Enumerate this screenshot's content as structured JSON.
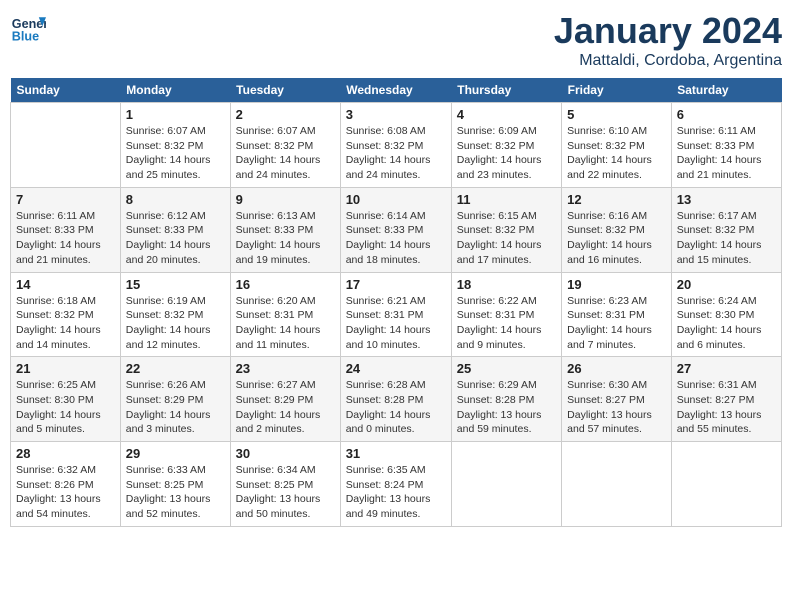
{
  "logo": {
    "line1": "General",
    "line2": "Blue"
  },
  "title": "January 2024",
  "location": "Mattaldi, Cordoba, Argentina",
  "days_header": [
    "Sunday",
    "Monday",
    "Tuesday",
    "Wednesday",
    "Thursday",
    "Friday",
    "Saturday"
  ],
  "weeks": [
    [
      {
        "day": "",
        "info": ""
      },
      {
        "day": "1",
        "info": "Sunrise: 6:07 AM\nSunset: 8:32 PM\nDaylight: 14 hours\nand 25 minutes."
      },
      {
        "day": "2",
        "info": "Sunrise: 6:07 AM\nSunset: 8:32 PM\nDaylight: 14 hours\nand 24 minutes."
      },
      {
        "day": "3",
        "info": "Sunrise: 6:08 AM\nSunset: 8:32 PM\nDaylight: 14 hours\nand 24 minutes."
      },
      {
        "day": "4",
        "info": "Sunrise: 6:09 AM\nSunset: 8:32 PM\nDaylight: 14 hours\nand 23 minutes."
      },
      {
        "day": "5",
        "info": "Sunrise: 6:10 AM\nSunset: 8:32 PM\nDaylight: 14 hours\nand 22 minutes."
      },
      {
        "day": "6",
        "info": "Sunrise: 6:11 AM\nSunset: 8:33 PM\nDaylight: 14 hours\nand 21 minutes."
      }
    ],
    [
      {
        "day": "7",
        "info": "Sunrise: 6:11 AM\nSunset: 8:33 PM\nDaylight: 14 hours\nand 21 minutes."
      },
      {
        "day": "8",
        "info": "Sunrise: 6:12 AM\nSunset: 8:33 PM\nDaylight: 14 hours\nand 20 minutes."
      },
      {
        "day": "9",
        "info": "Sunrise: 6:13 AM\nSunset: 8:33 PM\nDaylight: 14 hours\nand 19 minutes."
      },
      {
        "day": "10",
        "info": "Sunrise: 6:14 AM\nSunset: 8:33 PM\nDaylight: 14 hours\nand 18 minutes."
      },
      {
        "day": "11",
        "info": "Sunrise: 6:15 AM\nSunset: 8:32 PM\nDaylight: 14 hours\nand 17 minutes."
      },
      {
        "day": "12",
        "info": "Sunrise: 6:16 AM\nSunset: 8:32 PM\nDaylight: 14 hours\nand 16 minutes."
      },
      {
        "day": "13",
        "info": "Sunrise: 6:17 AM\nSunset: 8:32 PM\nDaylight: 14 hours\nand 15 minutes."
      }
    ],
    [
      {
        "day": "14",
        "info": "Sunrise: 6:18 AM\nSunset: 8:32 PM\nDaylight: 14 hours\nand 14 minutes."
      },
      {
        "day": "15",
        "info": "Sunrise: 6:19 AM\nSunset: 8:32 PM\nDaylight: 14 hours\nand 12 minutes."
      },
      {
        "day": "16",
        "info": "Sunrise: 6:20 AM\nSunset: 8:31 PM\nDaylight: 14 hours\nand 11 minutes."
      },
      {
        "day": "17",
        "info": "Sunrise: 6:21 AM\nSunset: 8:31 PM\nDaylight: 14 hours\nand 10 minutes."
      },
      {
        "day": "18",
        "info": "Sunrise: 6:22 AM\nSunset: 8:31 PM\nDaylight: 14 hours\nand 9 minutes."
      },
      {
        "day": "19",
        "info": "Sunrise: 6:23 AM\nSunset: 8:31 PM\nDaylight: 14 hours\nand 7 minutes."
      },
      {
        "day": "20",
        "info": "Sunrise: 6:24 AM\nSunset: 8:30 PM\nDaylight: 14 hours\nand 6 minutes."
      }
    ],
    [
      {
        "day": "21",
        "info": "Sunrise: 6:25 AM\nSunset: 8:30 PM\nDaylight: 14 hours\nand 5 minutes."
      },
      {
        "day": "22",
        "info": "Sunrise: 6:26 AM\nSunset: 8:29 PM\nDaylight: 14 hours\nand 3 minutes."
      },
      {
        "day": "23",
        "info": "Sunrise: 6:27 AM\nSunset: 8:29 PM\nDaylight: 14 hours\nand 2 minutes."
      },
      {
        "day": "24",
        "info": "Sunrise: 6:28 AM\nSunset: 8:28 PM\nDaylight: 14 hours\nand 0 minutes."
      },
      {
        "day": "25",
        "info": "Sunrise: 6:29 AM\nSunset: 8:28 PM\nDaylight: 13 hours\nand 59 minutes."
      },
      {
        "day": "26",
        "info": "Sunrise: 6:30 AM\nSunset: 8:27 PM\nDaylight: 13 hours\nand 57 minutes."
      },
      {
        "day": "27",
        "info": "Sunrise: 6:31 AM\nSunset: 8:27 PM\nDaylight: 13 hours\nand 55 minutes."
      }
    ],
    [
      {
        "day": "28",
        "info": "Sunrise: 6:32 AM\nSunset: 8:26 PM\nDaylight: 13 hours\nand 54 minutes."
      },
      {
        "day": "29",
        "info": "Sunrise: 6:33 AM\nSunset: 8:25 PM\nDaylight: 13 hours\nand 52 minutes."
      },
      {
        "day": "30",
        "info": "Sunrise: 6:34 AM\nSunset: 8:25 PM\nDaylight: 13 hours\nand 50 minutes."
      },
      {
        "day": "31",
        "info": "Sunrise: 6:35 AM\nSunset: 8:24 PM\nDaylight: 13 hours\nand 49 minutes."
      },
      {
        "day": "",
        "info": ""
      },
      {
        "day": "",
        "info": ""
      },
      {
        "day": "",
        "info": ""
      }
    ]
  ]
}
